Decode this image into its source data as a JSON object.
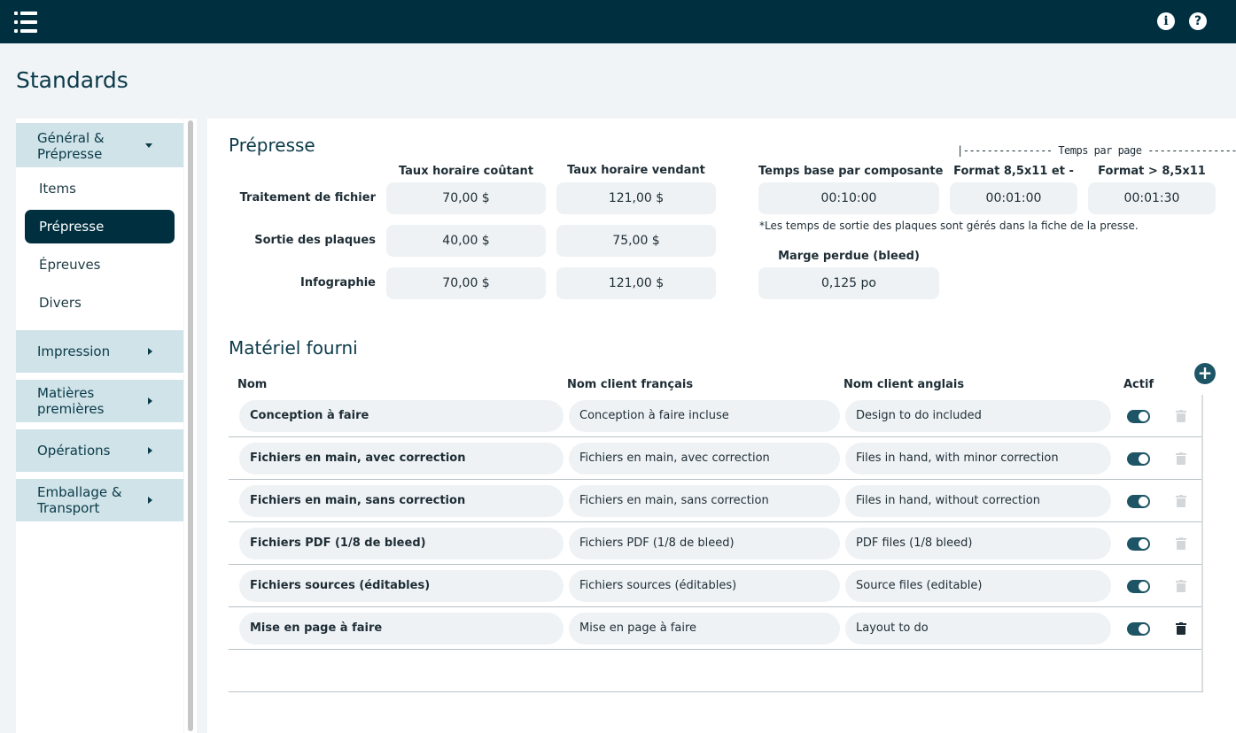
{
  "page": {
    "title": "Standards"
  },
  "topbar": {
    "info_icon": "info-circle-icon",
    "help_icon": "question-circle-icon"
  },
  "sidebar": {
    "sections": [
      {
        "label_line1": "Général &",
        "label_line2": "Prépresse",
        "expanded": true,
        "items": [
          "Items",
          "Prépresse",
          "Épreuves",
          "Divers"
        ],
        "active_item": "Prépresse"
      },
      {
        "label_line1": "Impression",
        "label_line2": ""
      },
      {
        "label_line1": "Matières",
        "label_line2": "premières"
      },
      {
        "label_line1": "Opérations",
        "label_line2": ""
      },
      {
        "label_line1": "Emballage &",
        "label_line2": "Transport"
      }
    ]
  },
  "prepresse": {
    "title": "Prépresse",
    "col_cost": "Taux horaire coûtant",
    "col_sell": "Taux horaire vendant",
    "rows": [
      {
        "label": "Traitement de fichier",
        "cost": "70,00 $",
        "sell": "121,00 $"
      },
      {
        "label": "Sortie des plaques",
        "cost": "40,00 $",
        "sell": "75,00 $"
      },
      {
        "label": "Infographie",
        "cost": "70,00 $",
        "sell": "121,00 $"
      }
    ],
    "temps_bracket": "|--------------- Temps par page ---------------|",
    "col_base": "Temps base par composante",
    "col_small": "Format 8,5x11 et -",
    "col_large": "Format > 8,5x11",
    "base_value": "00:10:00",
    "small_value": "00:01:00",
    "large_value": "00:01:30",
    "note": "*Les temps de sortie des plaques sont gérés dans la fiche de la presse.",
    "bleed_label": "Marge perdue (bleed)",
    "bleed_value": "0,125 po"
  },
  "materiel": {
    "title": "Matériel fourni",
    "headers": {
      "nom": "Nom",
      "fr": "Nom client français",
      "en": "Nom client anglais",
      "actif": "Actif"
    },
    "rows": [
      {
        "nom": "Conception à faire",
        "fr": "Conception à faire incluse",
        "en": "Design to do included",
        "actif": true,
        "deletable": false
      },
      {
        "nom": "Fichiers en main, avec correction",
        "fr": "Fichiers en main, avec correction",
        "en": "Files in hand, with minor correction",
        "actif": true,
        "deletable": false
      },
      {
        "nom": "Fichiers en main, sans correction",
        "fr": "Fichiers en main, sans correction",
        "en": "Files in hand, without correction",
        "actif": true,
        "deletable": false
      },
      {
        "nom": "Fichiers PDF (1/8 de bleed)",
        "fr": "Fichiers PDF (1/8 de bleed)",
        "en": "PDF files (1/8 bleed)",
        "actif": true,
        "deletable": false
      },
      {
        "nom": "Fichiers sources (éditables)",
        "fr": "Fichiers sources (éditables)",
        "en": "Source files (editable)",
        "actif": true,
        "deletable": false
      },
      {
        "nom": "Mise en page à faire",
        "fr": "Mise en page à faire",
        "en": "Layout to do",
        "actif": true,
        "deletable": true
      }
    ]
  },
  "colors": {
    "topbar": "#00303f",
    "accent": "#1d5566",
    "section_bg": "#cfe3e8",
    "field_bg": "#eef2f5"
  }
}
